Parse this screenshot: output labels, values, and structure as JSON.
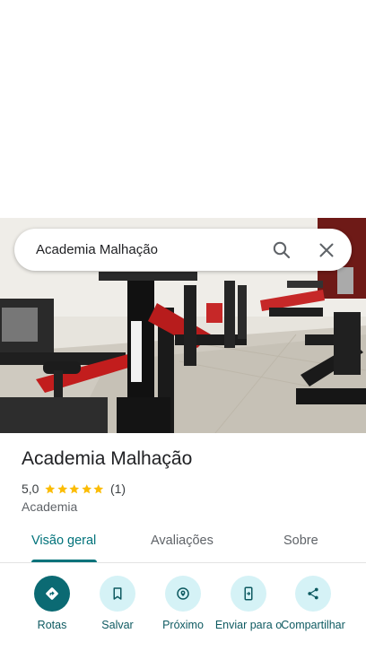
{
  "search": {
    "query": "Academia Malhação"
  },
  "place": {
    "name": "Academia Malhação",
    "rating": "5,0",
    "stars": 5,
    "review_count": "(1)",
    "category": "Academia"
  },
  "tabs": [
    {
      "label": "Visão geral",
      "active": true
    },
    {
      "label": "Avaliações",
      "active": false
    },
    {
      "label": "Sobre",
      "active": false
    }
  ],
  "actions": [
    {
      "label": "Rotas",
      "icon": "directions-icon"
    },
    {
      "label": "Salvar",
      "icon": "bookmark-icon"
    },
    {
      "label": "Próximo",
      "icon": "nearby-icon"
    },
    {
      "label": "Enviar para o",
      "icon": "send-to-phone-icon"
    },
    {
      "label": "Compartilhar",
      "icon": "share-icon"
    }
  ],
  "colors": {
    "accent": "#00727a",
    "action_primary": "#0b6a73",
    "action_secondary_bg": "#d5f2f6",
    "star": "#fbbc04"
  }
}
